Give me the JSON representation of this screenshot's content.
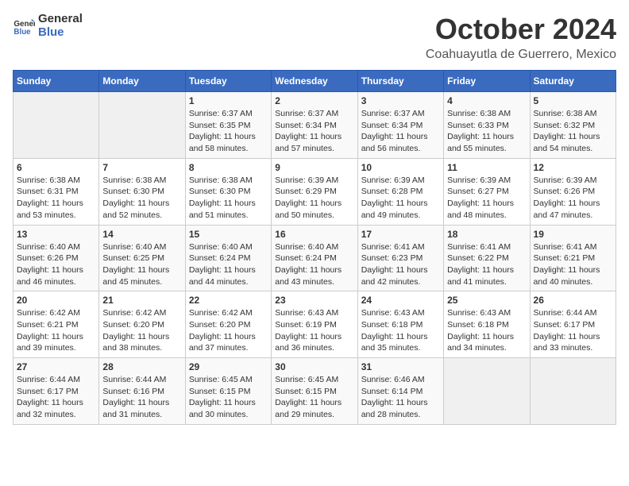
{
  "header": {
    "logo_line1": "General",
    "logo_line2": "Blue",
    "month": "October 2024",
    "location": "Coahuayutla de Guerrero, Mexico"
  },
  "weekdays": [
    "Sunday",
    "Monday",
    "Tuesday",
    "Wednesday",
    "Thursday",
    "Friday",
    "Saturday"
  ],
  "weeks": [
    [
      {
        "day": "",
        "sunrise": "",
        "sunset": "",
        "daylight": ""
      },
      {
        "day": "",
        "sunrise": "",
        "sunset": "",
        "daylight": ""
      },
      {
        "day": "1",
        "sunrise": "Sunrise: 6:37 AM",
        "sunset": "Sunset: 6:35 PM",
        "daylight": "Daylight: 11 hours and 58 minutes."
      },
      {
        "day": "2",
        "sunrise": "Sunrise: 6:37 AM",
        "sunset": "Sunset: 6:34 PM",
        "daylight": "Daylight: 11 hours and 57 minutes."
      },
      {
        "day": "3",
        "sunrise": "Sunrise: 6:37 AM",
        "sunset": "Sunset: 6:34 PM",
        "daylight": "Daylight: 11 hours and 56 minutes."
      },
      {
        "day": "4",
        "sunrise": "Sunrise: 6:38 AM",
        "sunset": "Sunset: 6:33 PM",
        "daylight": "Daylight: 11 hours and 55 minutes."
      },
      {
        "day": "5",
        "sunrise": "Sunrise: 6:38 AM",
        "sunset": "Sunset: 6:32 PM",
        "daylight": "Daylight: 11 hours and 54 minutes."
      }
    ],
    [
      {
        "day": "6",
        "sunrise": "Sunrise: 6:38 AM",
        "sunset": "Sunset: 6:31 PM",
        "daylight": "Daylight: 11 hours and 53 minutes."
      },
      {
        "day": "7",
        "sunrise": "Sunrise: 6:38 AM",
        "sunset": "Sunset: 6:30 PM",
        "daylight": "Daylight: 11 hours and 52 minutes."
      },
      {
        "day": "8",
        "sunrise": "Sunrise: 6:38 AM",
        "sunset": "Sunset: 6:30 PM",
        "daylight": "Daylight: 11 hours and 51 minutes."
      },
      {
        "day": "9",
        "sunrise": "Sunrise: 6:39 AM",
        "sunset": "Sunset: 6:29 PM",
        "daylight": "Daylight: 11 hours and 50 minutes."
      },
      {
        "day": "10",
        "sunrise": "Sunrise: 6:39 AM",
        "sunset": "Sunset: 6:28 PM",
        "daylight": "Daylight: 11 hours and 49 minutes."
      },
      {
        "day": "11",
        "sunrise": "Sunrise: 6:39 AM",
        "sunset": "Sunset: 6:27 PM",
        "daylight": "Daylight: 11 hours and 48 minutes."
      },
      {
        "day": "12",
        "sunrise": "Sunrise: 6:39 AM",
        "sunset": "Sunset: 6:26 PM",
        "daylight": "Daylight: 11 hours and 47 minutes."
      }
    ],
    [
      {
        "day": "13",
        "sunrise": "Sunrise: 6:40 AM",
        "sunset": "Sunset: 6:26 PM",
        "daylight": "Daylight: 11 hours and 46 minutes."
      },
      {
        "day": "14",
        "sunrise": "Sunrise: 6:40 AM",
        "sunset": "Sunset: 6:25 PM",
        "daylight": "Daylight: 11 hours and 45 minutes."
      },
      {
        "day": "15",
        "sunrise": "Sunrise: 6:40 AM",
        "sunset": "Sunset: 6:24 PM",
        "daylight": "Daylight: 11 hours and 44 minutes."
      },
      {
        "day": "16",
        "sunrise": "Sunrise: 6:40 AM",
        "sunset": "Sunset: 6:24 PM",
        "daylight": "Daylight: 11 hours and 43 minutes."
      },
      {
        "day": "17",
        "sunrise": "Sunrise: 6:41 AM",
        "sunset": "Sunset: 6:23 PM",
        "daylight": "Daylight: 11 hours and 42 minutes."
      },
      {
        "day": "18",
        "sunrise": "Sunrise: 6:41 AM",
        "sunset": "Sunset: 6:22 PM",
        "daylight": "Daylight: 11 hours and 41 minutes."
      },
      {
        "day": "19",
        "sunrise": "Sunrise: 6:41 AM",
        "sunset": "Sunset: 6:21 PM",
        "daylight": "Daylight: 11 hours and 40 minutes."
      }
    ],
    [
      {
        "day": "20",
        "sunrise": "Sunrise: 6:42 AM",
        "sunset": "Sunset: 6:21 PM",
        "daylight": "Daylight: 11 hours and 39 minutes."
      },
      {
        "day": "21",
        "sunrise": "Sunrise: 6:42 AM",
        "sunset": "Sunset: 6:20 PM",
        "daylight": "Daylight: 11 hours and 38 minutes."
      },
      {
        "day": "22",
        "sunrise": "Sunrise: 6:42 AM",
        "sunset": "Sunset: 6:20 PM",
        "daylight": "Daylight: 11 hours and 37 minutes."
      },
      {
        "day": "23",
        "sunrise": "Sunrise: 6:43 AM",
        "sunset": "Sunset: 6:19 PM",
        "daylight": "Daylight: 11 hours and 36 minutes."
      },
      {
        "day": "24",
        "sunrise": "Sunrise: 6:43 AM",
        "sunset": "Sunset: 6:18 PM",
        "daylight": "Daylight: 11 hours and 35 minutes."
      },
      {
        "day": "25",
        "sunrise": "Sunrise: 6:43 AM",
        "sunset": "Sunset: 6:18 PM",
        "daylight": "Daylight: 11 hours and 34 minutes."
      },
      {
        "day": "26",
        "sunrise": "Sunrise: 6:44 AM",
        "sunset": "Sunset: 6:17 PM",
        "daylight": "Daylight: 11 hours and 33 minutes."
      }
    ],
    [
      {
        "day": "27",
        "sunrise": "Sunrise: 6:44 AM",
        "sunset": "Sunset: 6:17 PM",
        "daylight": "Daylight: 11 hours and 32 minutes."
      },
      {
        "day": "28",
        "sunrise": "Sunrise: 6:44 AM",
        "sunset": "Sunset: 6:16 PM",
        "daylight": "Daylight: 11 hours and 31 minutes."
      },
      {
        "day": "29",
        "sunrise": "Sunrise: 6:45 AM",
        "sunset": "Sunset: 6:15 PM",
        "daylight": "Daylight: 11 hours and 30 minutes."
      },
      {
        "day": "30",
        "sunrise": "Sunrise: 6:45 AM",
        "sunset": "Sunset: 6:15 PM",
        "daylight": "Daylight: 11 hours and 29 minutes."
      },
      {
        "day": "31",
        "sunrise": "Sunrise: 6:46 AM",
        "sunset": "Sunset: 6:14 PM",
        "daylight": "Daylight: 11 hours and 28 minutes."
      },
      {
        "day": "",
        "sunrise": "",
        "sunset": "",
        "daylight": ""
      },
      {
        "day": "",
        "sunrise": "",
        "sunset": "",
        "daylight": ""
      }
    ]
  ]
}
